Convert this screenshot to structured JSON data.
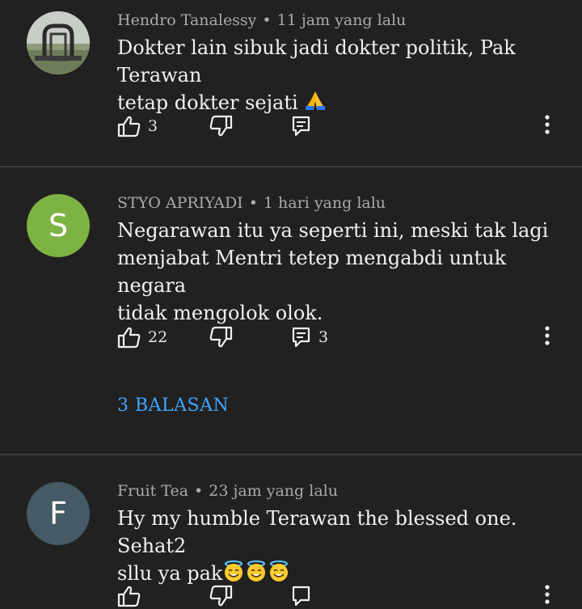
{
  "comments": [
    {
      "author": "Hendro Tanalessy",
      "time": "11 jam yang lalu",
      "text_line1": "Dokter lain sibuk jadi dokter politik, Pak Terawan",
      "text_line2": "tetap dokter sejati",
      "likes": "3",
      "reply_count": "",
      "avatar_type": "photo"
    },
    {
      "author": "STYO APRIYADI",
      "time": "1 hari yang lalu",
      "text_line1": "Negarawan itu ya seperti ini, meski tak lagi",
      "text_line2": "menjabat Mentri tetep mengabdi untuk negara",
      "text_line3": "tidak mengolok olok.",
      "likes": "22",
      "reply_count": "3",
      "replies_label": "3 BALASAN",
      "avatar_letter": "S",
      "avatar_color": "#7cb342"
    },
    {
      "author": "Fruit Tea",
      "time": "23 jam yang lalu",
      "text_line1": "Hy my humble Terawan the blessed one. Sehat2",
      "text_line2": "sllu ya pak",
      "avatar_letter": "F",
      "avatar_color": "#455a64"
    }
  ],
  "separator": "•",
  "icons": {
    "like": "thumbs-up-icon",
    "dislike": "thumbs-down-icon",
    "reply": "comment-reply-icon",
    "more": "more-vertical-icon",
    "pray": "folded-hands-emoji",
    "halo": "smiling-face-with-halo-emoji"
  }
}
